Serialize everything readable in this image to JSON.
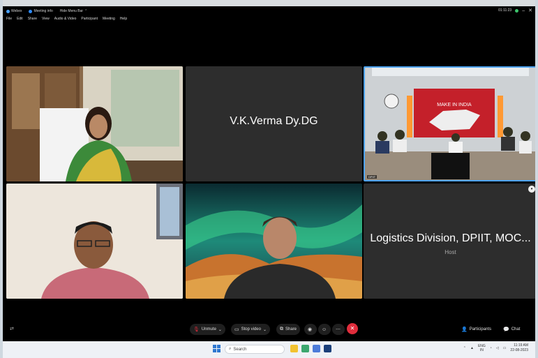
{
  "titlebar": {
    "app_name": "Webex",
    "meeting_info": "Meeting info",
    "hide_menu": "Hide Menu Bar",
    "timer": "01:11:23"
  },
  "menu": [
    "File",
    "Edit",
    "Share",
    "View",
    "Audio & Video",
    "Participant",
    "Meeting",
    "Help"
  ],
  "tiles": {
    "t2_name": "V.K.Verma Dy.DG",
    "t3_label": "DPIIT",
    "t3_banner": "MAKE IN INDIA",
    "t6_name": "Logistics Division, DPIIT, MOC...",
    "t6_role": "Host"
  },
  "toolbar": {
    "unmute": "Unmute",
    "stop_video": "Stop video",
    "share": "Share",
    "participants": "Participants",
    "chat": "Chat"
  },
  "taskbar": {
    "search_placeholder": "Search",
    "lang": "ENG",
    "lang2": "IN",
    "time": "11:19 AM",
    "date": "22-08-2023"
  },
  "colors": {
    "end_call": "#e02d3c",
    "active_speaker": "#4da3f0",
    "timer_dot": "#3cc36b"
  }
}
